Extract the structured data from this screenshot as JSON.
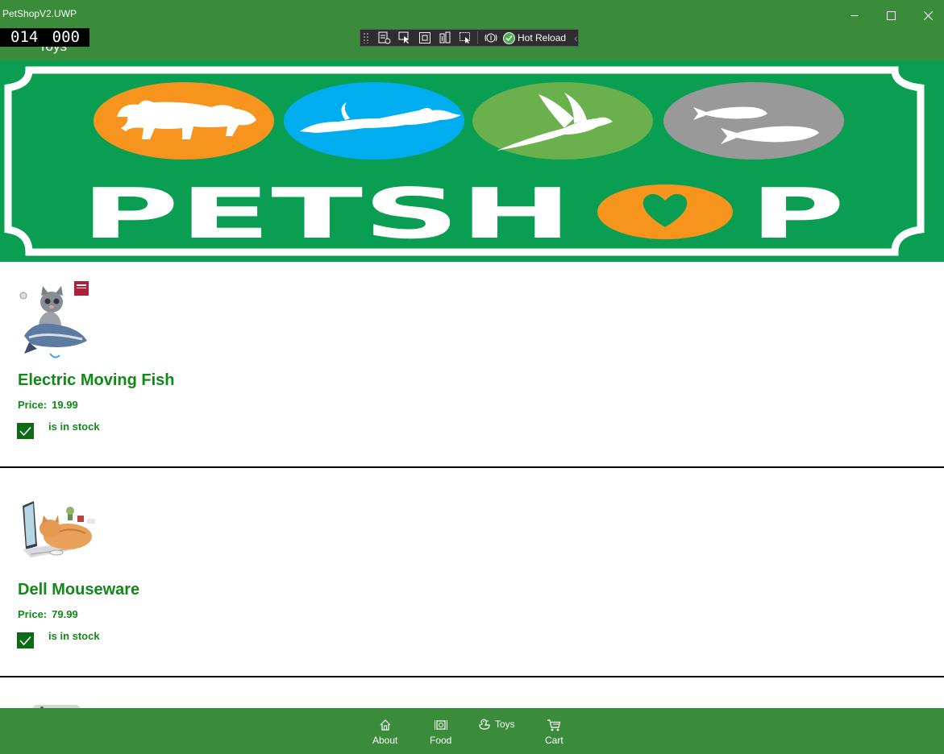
{
  "window": {
    "title": "PetShopV2.UWP",
    "page_title": "Toys",
    "frame_counter": {
      "left": "014",
      "right": "000"
    }
  },
  "dev_toolbar": {
    "icons": [
      "live-visual-tree-icon",
      "select-element-icon",
      "display-layout-adorners-icon",
      "track-focus-icon",
      "binding-failures-icon",
      "accessibility-icon"
    ],
    "hot_reload_label": "Hot Reload",
    "hot_reload_status": "ok"
  },
  "banner": {
    "logo_text": "PETSHOP",
    "colors": {
      "background": "#0a9e52",
      "dog": "#f7941d",
      "cat": "#00aeef",
      "bird": "#6ab04c",
      "fish": "#999999"
    }
  },
  "products": [
    {
      "name": "Electric Moving Fish",
      "price_label": "Price:",
      "price": "19.99",
      "in_stock": true,
      "stock_label": "is in stock"
    },
    {
      "name": "Dell Mouseware",
      "price_label": "Price:",
      "price": "79.99",
      "in_stock": true,
      "stock_label": "is in stock"
    }
  ],
  "bottom_nav": {
    "items": [
      {
        "label": "About",
        "icon": "home-icon"
      },
      {
        "label": "Food",
        "icon": "food-bowl-icon"
      },
      {
        "label": "Toys",
        "icon": "duck-toy-icon"
      },
      {
        "label": "Cart",
        "icon": "cart-icon"
      }
    ]
  },
  "colors": {
    "chrome": "#3a8c3a",
    "text_green": "#0f8a16",
    "checkbox": "#0c6b14"
  }
}
